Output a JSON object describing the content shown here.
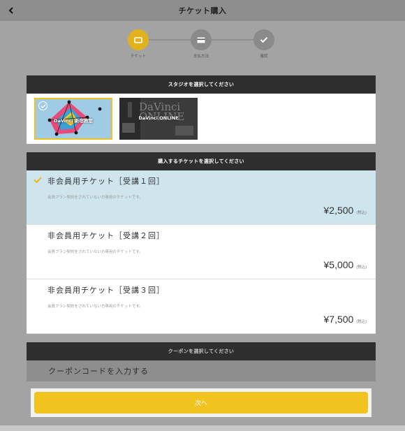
{
  "header": {
    "title": "チケット購入",
    "back_icon": "chevron-left-icon"
  },
  "stepper": {
    "steps": [
      {
        "label": "チケット",
        "icon": "ticket-icon",
        "state": "active"
      },
      {
        "label": "支払方法",
        "icon": "credit-card-icon",
        "state": "pending"
      },
      {
        "label": "確認",
        "icon": "check-icon",
        "state": "pending"
      }
    ]
  },
  "studio": {
    "heading": "スタジオを選択してください",
    "options": [
      {
        "name": "DaVinci 新宿教室",
        "selected": true
      },
      {
        "name": "DaVinci ONLINE",
        "watermark": "DaVinci ONLINE",
        "selected": false
      }
    ]
  },
  "tickets": {
    "heading": "購入するチケットを選択してください",
    "items": [
      {
        "name": "非会員用チケット［受講１回］",
        "desc": "会員プラン契約をされていない方専用のチケットです。",
        "price": "¥2,500",
        "tax": "(税込)",
        "selected": true
      },
      {
        "name": "非会員用チケット［受講２回］",
        "desc": "会員プラン契約をされていない方専用のチケットです。",
        "price": "¥5,000",
        "tax": "(税込)",
        "selected": false
      },
      {
        "name": "非会員用チケット［受講３回］",
        "desc": "会員プラン契約をされていない方専用のチケットです。",
        "price": "¥7,500",
        "tax": "(税込)",
        "selected": false
      }
    ]
  },
  "coupon": {
    "heading": "クーポンを選択してください",
    "input_label": "クーポンコードを入力する"
  },
  "actions": {
    "next_label": "次へ"
  },
  "colors": {
    "accent": "#f0c31f",
    "selected_row": "#cfe5ee",
    "header_bar": "#2e2e2e",
    "overlay": "#a3a3a3"
  }
}
